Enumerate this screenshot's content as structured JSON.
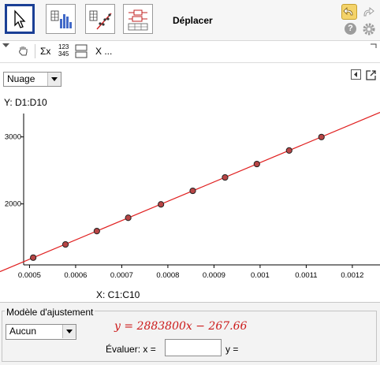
{
  "toolbar": {
    "title": "Déplacer",
    "tools": [
      {
        "name": "move-tool-button",
        "icon": "cursor-arrow-icon"
      },
      {
        "name": "one-variable-analysis-button",
        "icon": "histogram-icon"
      },
      {
        "name": "two-variable-regression-button",
        "icon": "scatter-regression-icon"
      },
      {
        "name": "multiple-variable-analysis-button",
        "icon": "boxplot-icon"
      }
    ],
    "undo_icon": "undo-icon",
    "redo_icon": "redo-icon",
    "help_label": "?",
    "settings_icon": "gear-icon"
  },
  "subbar": {
    "sum_label": "Σx",
    "numbers_top": "123",
    "numbers_bottom": "345",
    "x_label": "X ..."
  },
  "panel": {
    "plot_type": "Nuage"
  },
  "chart_data": {
    "type": "scatter",
    "ylabel": "Y:  D1:D10",
    "xlabel": "X:  C1:C10",
    "x_ticks": [
      "0.0005",
      "0.0006",
      "0.0007",
      "0.0008",
      "0.0009",
      "0.001",
      "0.0011",
      "0.0012"
    ],
    "x_tick_values": [
      0.0005,
      0.0006,
      0.0007,
      0.0008,
      0.0009,
      0.001,
      0.0011,
      0.0012
    ],
    "y_ticks": [
      "2000",
      "3000"
    ],
    "y_tick_values": [
      2000,
      3000
    ],
    "xlim": [
      0.000436,
      0.00126
    ],
    "ylim": [
      1090,
      3490
    ],
    "points": [
      {
        "x": 0.000508,
        "y": 1198
      },
      {
        "x": 0.000578,
        "y": 1395
      },
      {
        "x": 0.000646,
        "y": 1594
      },
      {
        "x": 0.000714,
        "y": 1793
      },
      {
        "x": 0.000785,
        "y": 1993
      },
      {
        "x": 0.000854,
        "y": 2195
      },
      {
        "x": 0.000924,
        "y": 2395
      },
      {
        "x": 0.000993,
        "y": 2595
      },
      {
        "x": 0.001063,
        "y": 2797
      },
      {
        "x": 0.001133,
        "y": 2998
      }
    ],
    "fit": {
      "slope": 2883800,
      "intercept": -267.66
    },
    "line_color": "#e02020",
    "point_color": "#b84545",
    "grid": false
  },
  "model": {
    "title": "Modèle d'ajustement",
    "fit_type": "Aucun",
    "equation": "y = 2883800x − 267.66",
    "evaluate_label": "Évaluer:  x =",
    "x_value": "",
    "y_label": "y ="
  }
}
